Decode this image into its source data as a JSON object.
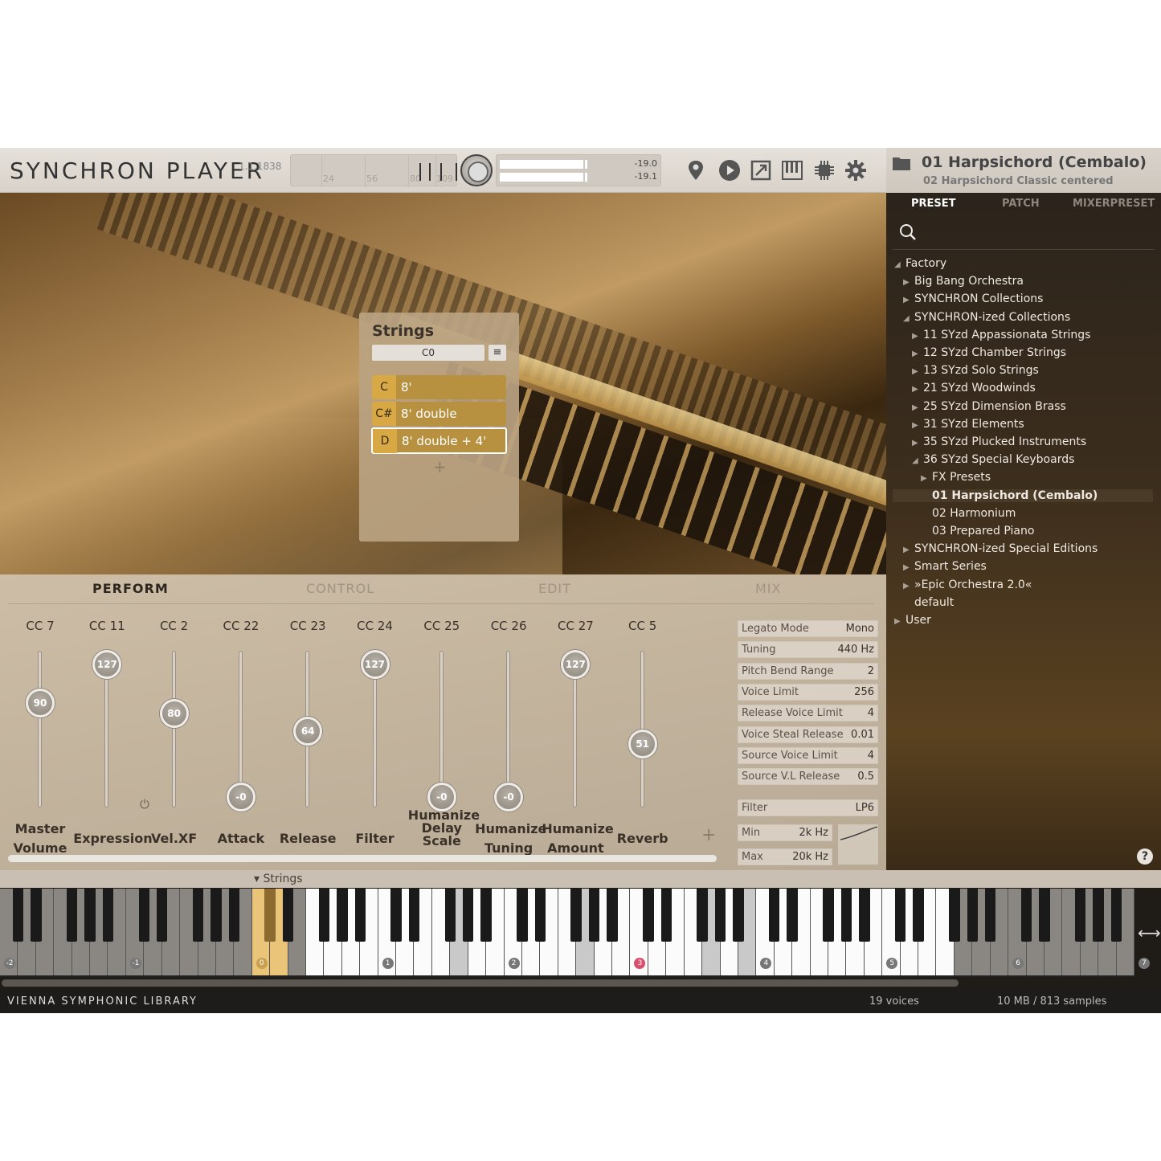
{
  "header": {
    "title": "SYNCHRON PLAYER",
    "version": "1.1.1838",
    "velocity_ticks": [
      "24",
      "56",
      "80",
      "109"
    ],
    "level_left": "-19.0",
    "level_right": "-19.1"
  },
  "toolbar_icons": [
    "location-pin-icon",
    "play-icon",
    "expand-icon",
    "keyboard-icon",
    "cpu-icon",
    "gear-icon"
  ],
  "preset": {
    "name": "01 Harpsichord (Cembalo)",
    "subtitle": "02 Harpsichord Classic centered"
  },
  "strings_panel": {
    "title": "Strings",
    "field": "C0",
    "rows": [
      {
        "key": "C",
        "label": "8'"
      },
      {
        "key": "C#",
        "label": "8' double"
      },
      {
        "key": "D",
        "label": "8' double + 4'"
      }
    ],
    "add": "+"
  },
  "tabs": [
    "PERFORM",
    "CONTROL",
    "EDIT",
    "MIX"
  ],
  "controls": [
    {
      "cc": "CC 7",
      "value": "90",
      "level": 0.71,
      "name": "Master Volume"
    },
    {
      "cc": "CC 11",
      "value": "127",
      "level": 1.0,
      "name": "Expression"
    },
    {
      "cc": "CC 2",
      "value": "80",
      "level": 0.63,
      "name": "Vel.XF"
    },
    {
      "cc": "CC 22",
      "value": "-0",
      "level": 0.0,
      "name": "Attack"
    },
    {
      "cc": "CC 23",
      "value": "64",
      "level": 0.5,
      "name": "Release"
    },
    {
      "cc": "CC 24",
      "value": "127",
      "level": 1.0,
      "name": "Filter"
    },
    {
      "cc": "CC 25",
      "value": "-0",
      "level": 0.0,
      "name": "Humanize Delay Scale"
    },
    {
      "cc": "CC 26",
      "value": "-0",
      "level": 0.0,
      "name": "Humanize Tuning"
    },
    {
      "cc": "CC 27",
      "value": "127",
      "level": 1.0,
      "name": "Humanize Amount"
    },
    {
      "cc": "CC 5",
      "value": "51",
      "level": 0.4,
      "name": "Reverb"
    }
  ],
  "add_control": "+",
  "params": [
    {
      "name": "Legato Mode",
      "value": "Mono"
    },
    {
      "name": "Tuning",
      "value": "440 Hz"
    },
    {
      "name": "Pitch Bend Range",
      "value": "2"
    },
    {
      "name": "Voice Limit",
      "value": "256"
    },
    {
      "name": "Release Voice Limit",
      "value": "4"
    },
    {
      "name": "Voice Steal Release",
      "value": "0.01"
    },
    {
      "name": "Source Voice Limit",
      "value": "4"
    },
    {
      "name": "Source V.L Release",
      "value": "0.5"
    }
  ],
  "filter": {
    "name": "Filter",
    "value": "LP6",
    "min_label": "Min",
    "min_value": "2k Hz",
    "max_label": "Max",
    "max_value": "20k Hz"
  },
  "browser": {
    "tabs": [
      "PRESET",
      "PATCH",
      "MIXERPRESET"
    ],
    "tree": [
      {
        "label": "Factory",
        "depth": 0,
        "icon": "expanded"
      },
      {
        "label": "Big Bang Orchestra",
        "depth": 1,
        "icon": "collapsed"
      },
      {
        "label": "SYNCHRON Collections",
        "depth": 1,
        "icon": "collapsed"
      },
      {
        "label": "SYNCHRON-ized Collections",
        "depth": 1,
        "icon": "expanded"
      },
      {
        "label": "11 SYzd Appassionata Strings",
        "depth": 2,
        "icon": "collapsed"
      },
      {
        "label": "12 SYzd Chamber Strings",
        "depth": 2,
        "icon": "collapsed"
      },
      {
        "label": "13 SYzd Solo Strings",
        "depth": 2,
        "icon": "collapsed"
      },
      {
        "label": "21 SYzd Woodwinds",
        "depth": 2,
        "icon": "collapsed"
      },
      {
        "label": "25 SYzd Dimension Brass",
        "depth": 2,
        "icon": "collapsed"
      },
      {
        "label": "31 SYzd Elements",
        "depth": 2,
        "icon": "collapsed"
      },
      {
        "label": "35 SYzd Plucked Instruments",
        "depth": 2,
        "icon": "collapsed"
      },
      {
        "label": "36 SYzd Special Keyboards",
        "depth": 2,
        "icon": "expanded"
      },
      {
        "label": "FX Presets",
        "depth": 3,
        "icon": "collapsed"
      },
      {
        "label": "01 Harpsichord (Cembalo)",
        "depth": 3,
        "icon": "none",
        "selected": true
      },
      {
        "label": "02 Harmonium",
        "depth": 3,
        "icon": "none"
      },
      {
        "label": "03 Prepared Piano",
        "depth": 3,
        "icon": "none"
      },
      {
        "label": "SYNCHRON-ized Special Editions",
        "depth": 1,
        "icon": "collapsed"
      },
      {
        "label": "Smart Series",
        "depth": 1,
        "icon": "collapsed"
      },
      {
        "label": "»Epic Orchestra 2.0«",
        "depth": 1,
        "icon": "collapsed"
      },
      {
        "label": "default",
        "depth": 1,
        "icon": "none"
      },
      {
        "label": "User",
        "depth": 0,
        "icon": "collapsed"
      }
    ],
    "help": "?"
  },
  "keyboard": {
    "label": "▾ Strings",
    "octave_labels": [
      "-2",
      "-1",
      "0",
      "1",
      "2",
      "3",
      "4",
      "5",
      "6",
      "7"
    ]
  },
  "footer": {
    "brand": "VIENNA SYMPHONIC LIBRARY",
    "voices": "19 voices",
    "samples": "10 MB / 813 samples"
  }
}
